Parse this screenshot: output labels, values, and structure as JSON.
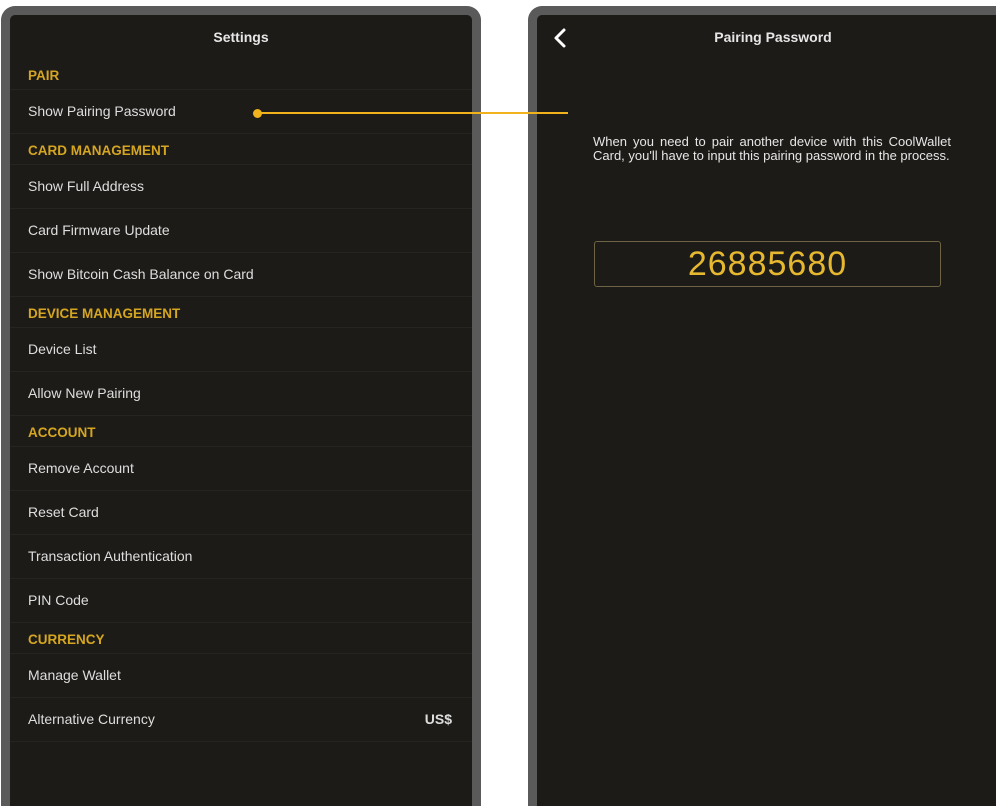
{
  "left_screen": {
    "title": "Settings",
    "sections": [
      {
        "header": "PAIR",
        "items": [
          {
            "label": "Show Pairing Password",
            "value": ""
          }
        ]
      },
      {
        "header": "CARD MANAGEMENT",
        "items": [
          {
            "label": "Show Full Address",
            "value": ""
          },
          {
            "label": "Card Firmware Update",
            "value": ""
          },
          {
            "label": "Show Bitcoin Cash Balance on Card",
            "value": ""
          }
        ]
      },
      {
        "header": "DEVICE MANAGEMENT",
        "items": [
          {
            "label": "Device List",
            "value": ""
          },
          {
            "label": "Allow New Pairing",
            "value": ""
          }
        ]
      },
      {
        "header": "ACCOUNT",
        "items": [
          {
            "label": "Remove Account",
            "value": ""
          },
          {
            "label": "Reset Card",
            "value": ""
          },
          {
            "label": "Transaction Authentication",
            "value": ""
          },
          {
            "label": "PIN Code",
            "value": ""
          }
        ]
      },
      {
        "header": "CURRENCY",
        "items": [
          {
            "label": "Manage Wallet",
            "value": ""
          },
          {
            "label": "Alternative Currency",
            "value": "US$"
          }
        ]
      }
    ]
  },
  "right_screen": {
    "title": "Pairing Password",
    "back_icon": "chevron-left-icon",
    "description": "When you need to pair another device with this CoolWallet Card, you'll have to input this pairing password in the process.",
    "pairing_password": "26885680"
  },
  "colors": {
    "background": "#1d1b18",
    "accent": "#d5a621",
    "callout": "#f2b21c",
    "frame": "#5a5a5a",
    "text": "#dedede"
  }
}
